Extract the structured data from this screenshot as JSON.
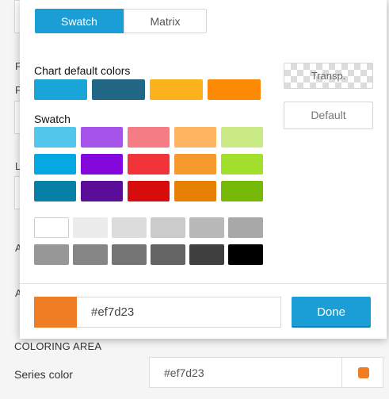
{
  "popover": {
    "tabs": [
      {
        "label": "Swatch",
        "active": true
      },
      {
        "label": "Matrix",
        "active": false
      }
    ],
    "chart_default_title": "Chart default colors",
    "chart_default_colors": [
      "#1aa5d8",
      "#226785",
      "#fcb21a",
      "#fd8a05"
    ],
    "swatch_title": "Swatch",
    "swatch_rows": [
      [
        "#53c6ec",
        "#a553e8",
        "#f57c84",
        "#fdb562",
        "#c9ea85"
      ],
      [
        "#05a8e2",
        "#8408dc",
        "#f2343a",
        "#f69a2e",
        "#a3e02e"
      ],
      [
        "#0680a7",
        "#5c0d98",
        "#d70c0c",
        "#e68105",
        "#77b907"
      ]
    ],
    "gray_rows": [
      [
        "#ffffff",
        "#ececec",
        "#dcdcdc",
        "#cbcbcb",
        "#b9b9b9",
        "#a8a8a8"
      ],
      [
        "#979797",
        "#868686",
        "#757575",
        "#646464",
        "#404040",
        "#000000"
      ]
    ],
    "transparent_label": "Transp.",
    "default_label": "Default",
    "current_color": "#ef7d23",
    "hex_value": "#ef7d23",
    "done_label": "Done"
  },
  "background": {
    "coloring_area_label": "COLORING AREA",
    "series_color_label": "Series color",
    "series_color_value": "#ef7d23",
    "series_color_swatch": "#ef7d23"
  }
}
